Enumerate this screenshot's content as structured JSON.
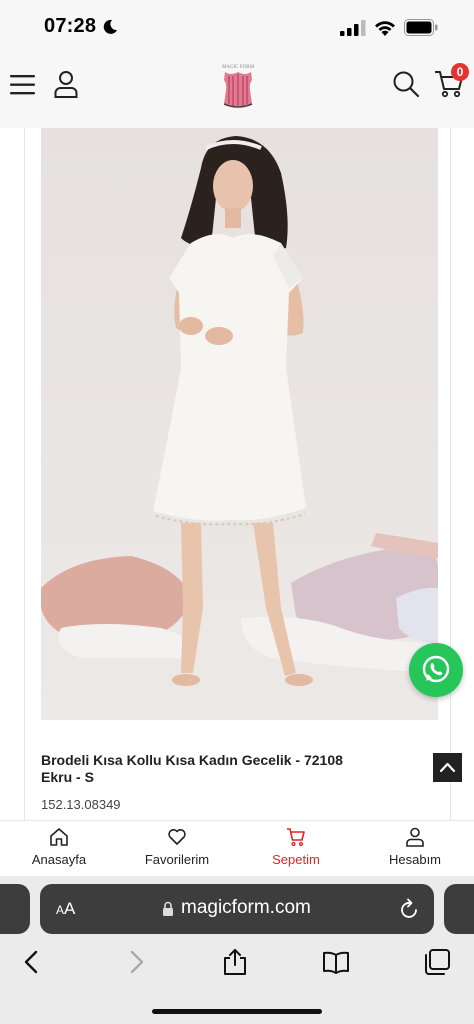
{
  "status_bar": {
    "time": "07:28",
    "icons": [
      "moon-icon",
      "cellular-signal-icon",
      "wifi-icon",
      "battery-icon"
    ]
  },
  "header": {
    "icons": [
      "menu-icon",
      "user-icon",
      "search-icon",
      "cart-icon"
    ],
    "logo_text": "MAGIC FORM",
    "cart_count": "0",
    "badge_color": "#e5342f"
  },
  "product": {
    "title": "Brodeli Kısa Kollu Kısa Kadın Gecelik - 72108 Ekru - S",
    "code": "152.13.08349",
    "image_subject": "woman wearing white short-sleeve embroidered nightgown"
  },
  "floating": {
    "whatsapp_icon": "whatsapp-icon",
    "scroll_top_icon": "chevron-up-icon",
    "whatsapp_color": "#26c65a"
  },
  "bottom_nav": {
    "items": [
      {
        "label": "Anasayfa",
        "icon": "home-icon"
      },
      {
        "label": "Favorilerim",
        "icon": "heart-icon"
      },
      {
        "label": "Sepetim",
        "icon": "cart-icon",
        "active": true
      },
      {
        "label": "Hesabım",
        "icon": "user-icon"
      }
    ],
    "active_color": "#e02525"
  },
  "browser": {
    "aa_label": "AA",
    "url": "magicform.com",
    "toolbar": [
      "back-icon",
      "forward-icon",
      "share-icon",
      "bookmarks-icon",
      "tabs-icon"
    ]
  }
}
